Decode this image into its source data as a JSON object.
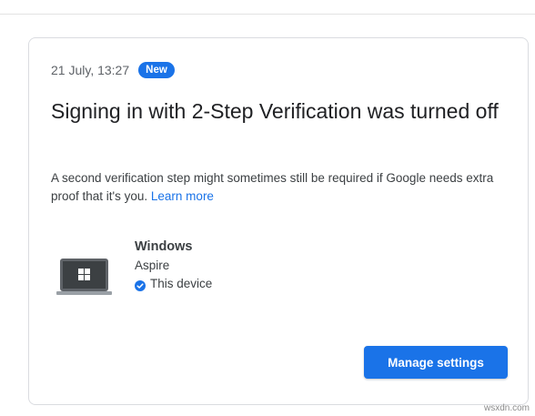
{
  "notification": {
    "timestamp": "21 July, 13:27",
    "badge": "New",
    "title": "Signing in with 2-Step Verification was turned off",
    "description": "A second verification step might sometimes still be required if Google needs extra proof that it's you.",
    "learn_more": "Learn more"
  },
  "device": {
    "icon": "laptop-windows-icon",
    "name": "Windows",
    "model": "Aspire",
    "status": "This device",
    "status_icon": "verified-check-icon"
  },
  "actions": {
    "manage_settings": "Manage settings"
  },
  "watermark": "wsxdn.com",
  "colors": {
    "accent": "#1a73e8",
    "text_primary": "#202124",
    "text_secondary": "#5f6368",
    "border": "#dadce0"
  }
}
